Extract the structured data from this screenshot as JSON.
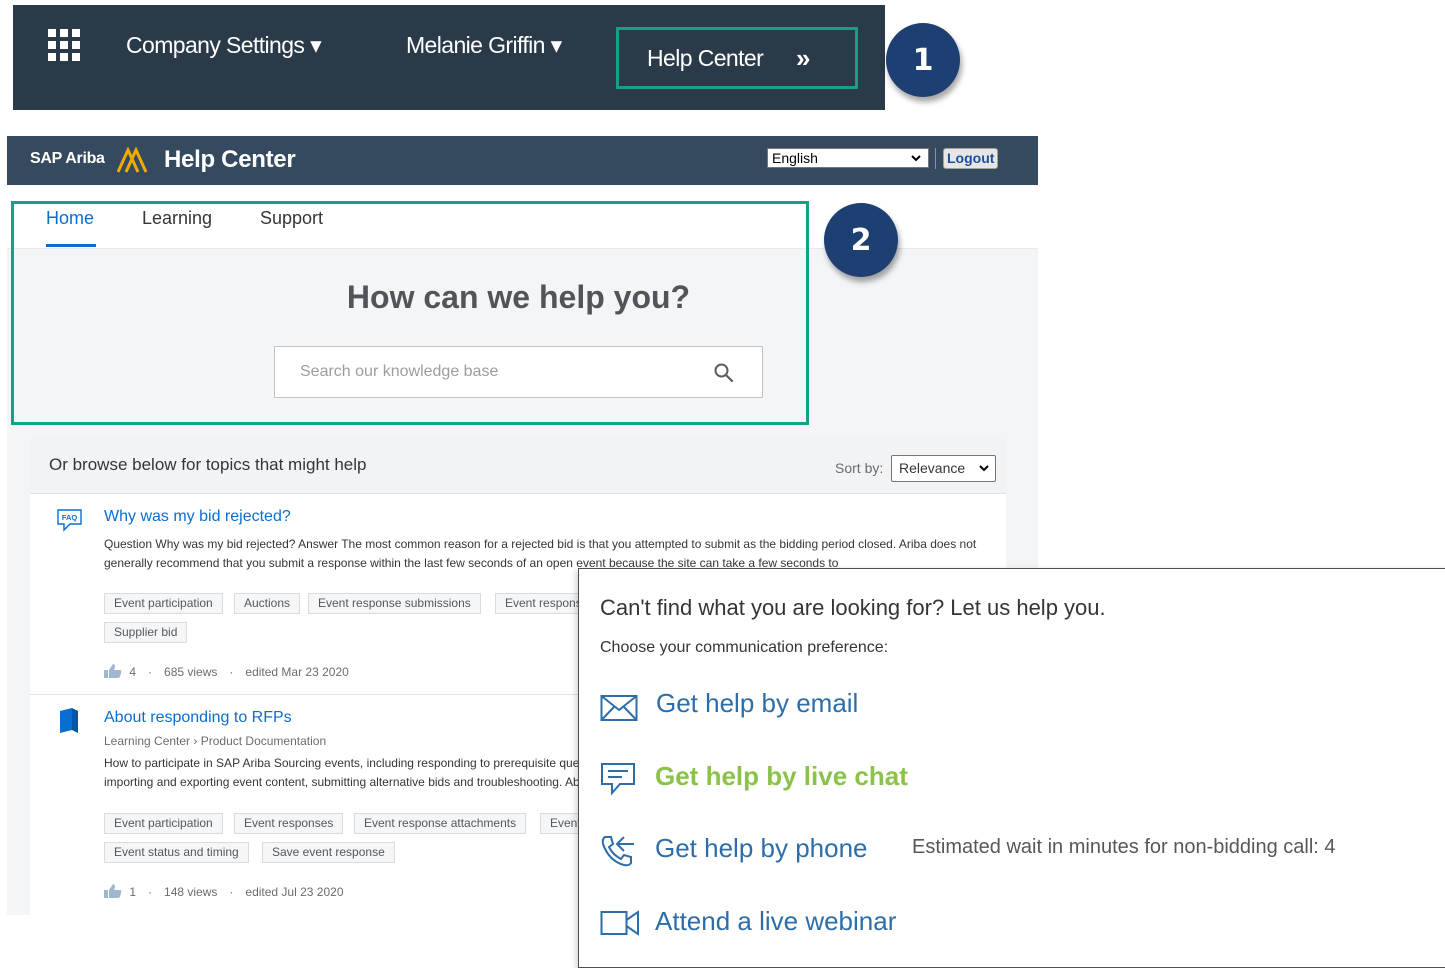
{
  "top_nav": {
    "company_settings": "Company Settings ▾",
    "user_menu": "Melanie Griffin ▾",
    "help_center": "Help Center",
    "help_arrow": "»"
  },
  "steps": {
    "one": "1",
    "two": "2"
  },
  "header": {
    "brand": "SAP Ariba",
    "title": "Help Center",
    "language": "English",
    "logout": "Logout"
  },
  "tabs": [
    {
      "label": "Home",
      "active": true
    },
    {
      "label": "Learning"
    },
    {
      "label": "Support"
    }
  ],
  "hero": {
    "title": "How can we help you?",
    "search_placeholder": "Search our knowledge base"
  },
  "browse": {
    "text": "Or browse below for topics that might help",
    "sort_label": "Sort by:",
    "sort_value": "Relevance"
  },
  "results": [
    {
      "icon": "faq-icon",
      "icon_text": "FAQ",
      "title": "Why was my bid rejected?",
      "body": "Question Why was my bid rejected? Answer The most common reason for a rejected bid is that you attempted to submit as the bidding period closed. Ariba does not generally recommend that you submit a response within the last few seconds of an open event because the site can take a few seconds to",
      "tags": [
        "Event participation",
        "Auctions",
        "Event response submissions",
        "Event responses",
        "Supplier bid"
      ],
      "likes": "4",
      "views": "685 views",
      "edited": "edited Mar 23 2020"
    },
    {
      "icon": "book-icon",
      "title": "About responding to RFPs",
      "breadcrumb": "Learning Center › Product Documentation",
      "body": "How to participate in SAP Ariba Sourcing events, including responding to prerequisite questions, submitting and revising responses, communicating with buyers, importing and exporting event content, submitting alternative bids and troubleshooting. About responding to",
      "tags": [
        "Event participation",
        "Event responses",
        "Event response attachments",
        "Event response submissions",
        "Event status and timing",
        "Save event response"
      ],
      "likes": "1",
      "views": "148 views",
      "edited": "edited Jul 23 2020"
    }
  ],
  "help_panel": {
    "title": "Can't find what you are looking for? Let us help you.",
    "subtitle": "Choose your communication preference:",
    "email": "Get help by email",
    "chat": "Get help by live chat",
    "phone": "Get help by phone",
    "wait": "Estimated wait in minutes for non-bidding call: 4",
    "webinar": "Attend a live webinar"
  },
  "colors": {
    "nav_bg": "#2b3a48",
    "header_bg": "#354a5f",
    "highlight": "#16a085",
    "step_circle": "#1d3f72",
    "link": "#0a6ed1",
    "chat_green": "#8bc34a"
  }
}
